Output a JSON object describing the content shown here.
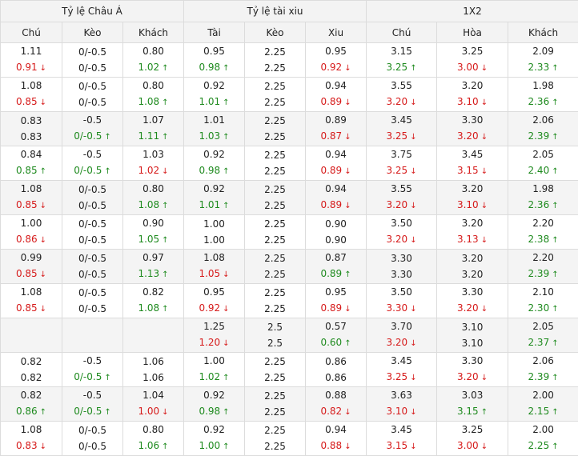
{
  "groups": [
    "Tỷ lệ Châu Á",
    "Tỷ lệ tài xiu",
    "1X2"
  ],
  "columns": [
    "Chú",
    "Kèo",
    "Khách",
    "Tài",
    "Kèo",
    "Xiu",
    "Chú",
    "Hòa",
    "Khách"
  ],
  "rows": [
    {
      "alt": false,
      "cells": [
        [
          "1.11",
          ""
        ],
        [
          "0/-0.5",
          ""
        ],
        [
          "0.80",
          ""
        ],
        [
          "0.95",
          ""
        ],
        [
          "2.25",
          ""
        ],
        [
          "0.95",
          ""
        ],
        [
          "3.15",
          ""
        ],
        [
          "3.25",
          ""
        ],
        [
          "2.09",
          ""
        ]
      ],
      "cells2": [
        [
          "0.91",
          "down"
        ],
        [
          "0/-0.5",
          ""
        ],
        [
          "1.02",
          "up"
        ],
        [
          "0.98",
          "up"
        ],
        [
          "2.25",
          ""
        ],
        [
          "0.92",
          "down"
        ],
        [
          "3.25",
          "up"
        ],
        [
          "3.00",
          "down"
        ],
        [
          "2.33",
          "up"
        ]
      ]
    },
    {
      "alt": false,
      "cells": [
        [
          "1.08",
          ""
        ],
        [
          "0/-0.5",
          ""
        ],
        [
          "0.80",
          ""
        ],
        [
          "0.92",
          ""
        ],
        [
          "2.25",
          ""
        ],
        [
          "0.94",
          ""
        ],
        [
          "3.55",
          ""
        ],
        [
          "3.20",
          ""
        ],
        [
          "1.98",
          ""
        ]
      ],
      "cells2": [
        [
          "0.85",
          "down"
        ],
        [
          "0/-0.5",
          ""
        ],
        [
          "1.08",
          "up"
        ],
        [
          "1.01",
          "up"
        ],
        [
          "2.25",
          ""
        ],
        [
          "0.89",
          "down"
        ],
        [
          "3.20",
          "down"
        ],
        [
          "3.10",
          "down"
        ],
        [
          "2.36",
          "up"
        ]
      ]
    },
    {
      "alt": true,
      "cells": [
        [
          "0.83",
          ""
        ],
        [
          "-0.5",
          ""
        ],
        [
          "1.07",
          ""
        ],
        [
          "1.01",
          ""
        ],
        [
          "2.25",
          ""
        ],
        [
          "0.89",
          ""
        ],
        [
          "3.45",
          ""
        ],
        [
          "3.30",
          ""
        ],
        [
          "2.06",
          ""
        ]
      ],
      "cells2": [
        [
          "0.83",
          ""
        ],
        [
          "0/-0.5",
          "up"
        ],
        [
          "1.11",
          "up"
        ],
        [
          "1.03",
          "up"
        ],
        [
          "2.25",
          ""
        ],
        [
          "0.87",
          "down"
        ],
        [
          "3.25",
          "down"
        ],
        [
          "3.20",
          "down"
        ],
        [
          "2.39",
          "up"
        ]
      ]
    },
    {
      "alt": false,
      "cells": [
        [
          "0.84",
          ""
        ],
        [
          "-0.5",
          ""
        ],
        [
          "1.03",
          ""
        ],
        [
          "0.92",
          ""
        ],
        [
          "2.25",
          ""
        ],
        [
          "0.94",
          ""
        ],
        [
          "3.75",
          ""
        ],
        [
          "3.45",
          ""
        ],
        [
          "2.05",
          ""
        ]
      ],
      "cells2": [
        [
          "0.85",
          "up"
        ],
        [
          "0/-0.5",
          "up"
        ],
        [
          "1.02",
          "down"
        ],
        [
          "0.98",
          "up"
        ],
        [
          "2.25",
          ""
        ],
        [
          "0.89",
          "down"
        ],
        [
          "3.25",
          "down"
        ],
        [
          "3.15",
          "down"
        ],
        [
          "2.40",
          "up"
        ]
      ]
    },
    {
      "alt": true,
      "cells": [
        [
          "1.08",
          ""
        ],
        [
          "0/-0.5",
          ""
        ],
        [
          "0.80",
          ""
        ],
        [
          "0.92",
          ""
        ],
        [
          "2.25",
          ""
        ],
        [
          "0.94",
          ""
        ],
        [
          "3.55",
          ""
        ],
        [
          "3.20",
          ""
        ],
        [
          "1.98",
          ""
        ]
      ],
      "cells2": [
        [
          "0.85",
          "down"
        ],
        [
          "0/-0.5",
          ""
        ],
        [
          "1.08",
          "up"
        ],
        [
          "1.01",
          "up"
        ],
        [
          "2.25",
          ""
        ],
        [
          "0.89",
          "down"
        ],
        [
          "3.20",
          "down"
        ],
        [
          "3.10",
          "down"
        ],
        [
          "2.36",
          "up"
        ]
      ]
    },
    {
      "alt": false,
      "cells": [
        [
          "1.00",
          ""
        ],
        [
          "0/-0.5",
          ""
        ],
        [
          "0.90",
          ""
        ],
        [
          "1.00",
          ""
        ],
        [
          "2.25",
          ""
        ],
        [
          "0.90",
          ""
        ],
        [
          "3.50",
          ""
        ],
        [
          "3.20",
          ""
        ],
        [
          "2.20",
          ""
        ]
      ],
      "cells2": [
        [
          "0.86",
          "down"
        ],
        [
          "0/-0.5",
          ""
        ],
        [
          "1.05",
          "up"
        ],
        [
          "1.00",
          ""
        ],
        [
          "2.25",
          ""
        ],
        [
          "0.90",
          ""
        ],
        [
          "3.20",
          "down"
        ],
        [
          "3.13",
          "down"
        ],
        [
          "2.38",
          "up"
        ]
      ]
    },
    {
      "alt": true,
      "cells": [
        [
          "0.99",
          ""
        ],
        [
          "0/-0.5",
          ""
        ],
        [
          "0.97",
          ""
        ],
        [
          "1.08",
          ""
        ],
        [
          "2.25",
          ""
        ],
        [
          "0.87",
          ""
        ],
        [
          "3.30",
          ""
        ],
        [
          "3.20",
          ""
        ],
        [
          "2.20",
          ""
        ]
      ],
      "cells2": [
        [
          "0.85",
          "down"
        ],
        [
          "0/-0.5",
          ""
        ],
        [
          "1.13",
          "up"
        ],
        [
          "1.05",
          "down"
        ],
        [
          "2.25",
          ""
        ],
        [
          "0.89",
          "up"
        ],
        [
          "3.30",
          ""
        ],
        [
          "3.20",
          ""
        ],
        [
          "2.39",
          "up"
        ]
      ]
    },
    {
      "alt": false,
      "cells": [
        [
          "1.08",
          ""
        ],
        [
          "0/-0.5",
          ""
        ],
        [
          "0.82",
          ""
        ],
        [
          "0.95",
          ""
        ],
        [
          "2.25",
          ""
        ],
        [
          "0.95",
          ""
        ],
        [
          "3.50",
          ""
        ],
        [
          "3.30",
          ""
        ],
        [
          "2.10",
          ""
        ]
      ],
      "cells2": [
        [
          "0.85",
          "down"
        ],
        [
          "0/-0.5",
          ""
        ],
        [
          "1.08",
          "up"
        ],
        [
          "0.92",
          "down"
        ],
        [
          "2.25",
          ""
        ],
        [
          "0.89",
          "down"
        ],
        [
          "3.30",
          "down"
        ],
        [
          "3.20",
          "down"
        ],
        [
          "2.30",
          "up"
        ]
      ]
    },
    {
      "alt": true,
      "cells": [
        [
          "",
          ""
        ],
        [
          "",
          ""
        ],
        [
          "",
          ""
        ],
        [
          "1.25",
          ""
        ],
        [
          "2.5",
          ""
        ],
        [
          "0.57",
          ""
        ],
        [
          "3.70",
          ""
        ],
        [
          "3.10",
          ""
        ],
        [
          "2.05",
          ""
        ]
      ],
      "cells2": [
        [
          "",
          ""
        ],
        [
          "",
          ""
        ],
        [
          "",
          ""
        ],
        [
          "1.20",
          "down"
        ],
        [
          "2.5",
          ""
        ],
        [
          "0.60",
          "up"
        ],
        [
          "3.20",
          "down"
        ],
        [
          "3.10",
          ""
        ],
        [
          "2.37",
          "up"
        ]
      ]
    },
    {
      "alt": false,
      "cells": [
        [
          "0.82",
          ""
        ],
        [
          "-0.5",
          ""
        ],
        [
          "1.06",
          ""
        ],
        [
          "1.00",
          ""
        ],
        [
          "2.25",
          ""
        ],
        [
          "0.86",
          ""
        ],
        [
          "3.45",
          ""
        ],
        [
          "3.30",
          ""
        ],
        [
          "2.06",
          ""
        ]
      ],
      "cells2": [
        [
          "0.82",
          ""
        ],
        [
          "0/-0.5",
          "up"
        ],
        [
          "1.06",
          ""
        ],
        [
          "1.02",
          "up"
        ],
        [
          "2.25",
          ""
        ],
        [
          "0.86",
          ""
        ],
        [
          "3.25",
          "down"
        ],
        [
          "3.20",
          "down"
        ],
        [
          "2.39",
          "up"
        ]
      ]
    },
    {
      "alt": true,
      "cells": [
        [
          "0.82",
          ""
        ],
        [
          "-0.5",
          ""
        ],
        [
          "1.04",
          ""
        ],
        [
          "0.92",
          ""
        ],
        [
          "2.25",
          ""
        ],
        [
          "0.88",
          ""
        ],
        [
          "3.63",
          ""
        ],
        [
          "3.03",
          ""
        ],
        [
          "2.00",
          ""
        ]
      ],
      "cells2": [
        [
          "0.86",
          "up"
        ],
        [
          "0/-0.5",
          "up"
        ],
        [
          "1.00",
          "down"
        ],
        [
          "0.98",
          "up"
        ],
        [
          "2.25",
          ""
        ],
        [
          "0.82",
          "down"
        ],
        [
          "3.10",
          "down"
        ],
        [
          "3.15",
          "up"
        ],
        [
          "2.15",
          "up"
        ]
      ]
    },
    {
      "alt": false,
      "cells": [
        [
          "1.08",
          ""
        ],
        [
          "0/-0.5",
          ""
        ],
        [
          "0.80",
          ""
        ],
        [
          "0.92",
          ""
        ],
        [
          "2.25",
          ""
        ],
        [
          "0.94",
          ""
        ],
        [
          "3.45",
          ""
        ],
        [
          "3.25",
          ""
        ],
        [
          "2.00",
          ""
        ]
      ],
      "cells2": [
        [
          "0.83",
          "down"
        ],
        [
          "0/-0.5",
          ""
        ],
        [
          "1.06",
          "up"
        ],
        [
          "1.00",
          "up"
        ],
        [
          "2.25",
          ""
        ],
        [
          "0.88",
          "down"
        ],
        [
          "3.15",
          "down"
        ],
        [
          "3.00",
          "down"
        ],
        [
          "2.25",
          "up"
        ]
      ]
    }
  ]
}
